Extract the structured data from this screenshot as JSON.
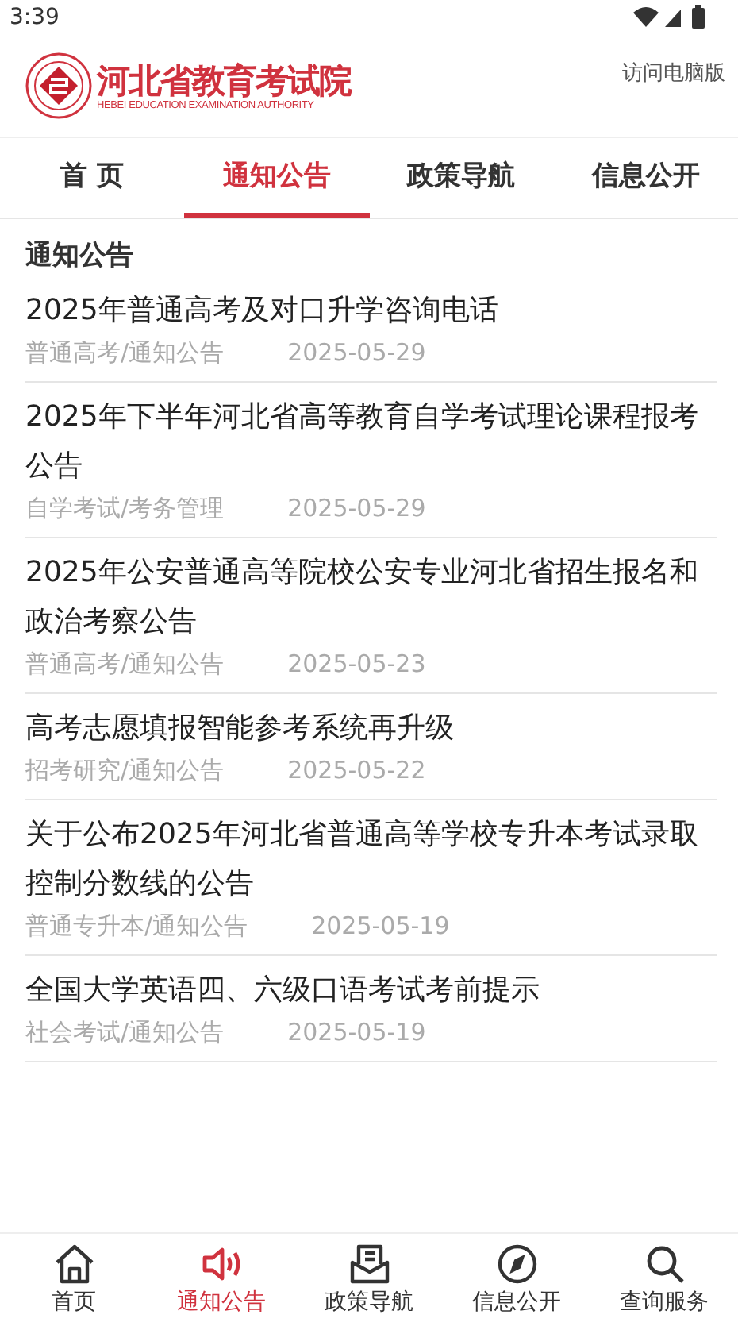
{
  "status_bar": {
    "time": "3:39"
  },
  "header": {
    "logo_title": "河北省教育考试院",
    "logo_subtitle": "HEBEI EDUCATION EXAMINATION AUTHORITY",
    "desktop_link": "访问电脑版"
  },
  "tabs": [
    {
      "label": "首 页",
      "selected": false
    },
    {
      "label": "通知公告",
      "selected": true
    },
    {
      "label": "政策导航",
      "selected": false
    },
    {
      "label": "信息公开",
      "selected": false
    }
  ],
  "section_title": "通知公告",
  "articles": [
    {
      "title": "2025年普通高考及对口升学咨询电话",
      "category": "普通高考/通知公告",
      "date": "2025-05-29"
    },
    {
      "title": "2025年下半年河北省高等教育自学考试理论课程报考公告",
      "category": "自学考试/考务管理",
      "date": "2025-05-29"
    },
    {
      "title": "2025年公安普通高等院校公安专业河北省招生报名和政治考察公告",
      "category": "普通高考/通知公告",
      "date": "2025-05-23"
    },
    {
      "title": "高考志愿填报智能参考系统再升级",
      "category": "招考研究/通知公告",
      "date": "2025-05-22"
    },
    {
      "title": "关于公布2025年河北省普通高等学校专升本考试录取控制分数线的公告",
      "category": "普通专升本/通知公告",
      "date": "2025-05-19"
    },
    {
      "title": "全国大学英语四、六级口语考试考前提示",
      "category": "社会考试/通知公告",
      "date": "2025-05-19"
    }
  ],
  "bottom_nav": [
    {
      "kind": "home",
      "label": "首页",
      "selected": false
    },
    {
      "kind": "speaker",
      "label": "通知公告",
      "selected": true
    },
    {
      "kind": "inbox",
      "label": "政策导航",
      "selected": false
    },
    {
      "kind": "compass",
      "label": "信息公开",
      "selected": false
    },
    {
      "kind": "search",
      "label": "查询服务",
      "selected": false
    }
  ]
}
